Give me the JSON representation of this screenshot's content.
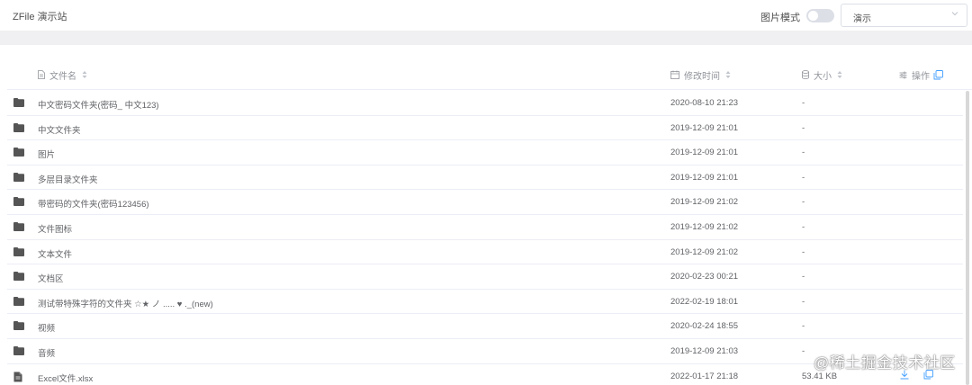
{
  "header": {
    "site_title": "ZFile 演示站",
    "image_mode_label": "图片模式",
    "image_mode_on": false,
    "drive_select_value": "演示"
  },
  "table": {
    "columns": {
      "name": "文件名",
      "time": "修改时间",
      "size": "大小",
      "ops": "操作"
    },
    "rows": [
      {
        "type": "folder",
        "name": "中文密码文件夹(密码_ 中文123)",
        "time": "2020-08-10 21:23",
        "size": "-"
      },
      {
        "type": "folder",
        "name": "中文文件夹",
        "time": "2019-12-09 21:01",
        "size": "-"
      },
      {
        "type": "folder",
        "name": "图片",
        "time": "2019-12-09 21:01",
        "size": "-"
      },
      {
        "type": "folder",
        "name": "多层目录文件夹",
        "time": "2019-12-09 21:01",
        "size": "-"
      },
      {
        "type": "folder",
        "name": "带密码的文件夹(密码123456)",
        "time": "2019-12-09 21:02",
        "size": "-"
      },
      {
        "type": "folder",
        "name": "文件图标",
        "time": "2019-12-09 21:02",
        "size": "-"
      },
      {
        "type": "folder",
        "name": "文本文件",
        "time": "2019-12-09 21:02",
        "size": "-"
      },
      {
        "type": "folder",
        "name": "文档区",
        "time": "2020-02-23 00:21",
        "size": "-"
      },
      {
        "type": "folder",
        "name": "测试带特殊字符的文件夹 ☆★ ノ ..... ♥ ._(new)",
        "time": "2022-02-19 18:01",
        "size": "-"
      },
      {
        "type": "folder",
        "name": "视频",
        "time": "2020-02-24 18:55",
        "size": "-"
      },
      {
        "type": "folder",
        "name": "音频",
        "time": "2019-12-09 21:03",
        "size": "-"
      },
      {
        "type": "file",
        "name": "Excel文件.xlsx",
        "time": "2022-01-17 21:18",
        "size": "53.41 KB"
      }
    ]
  },
  "watermark": "@稀土掘金技术社区",
  "colors": {
    "accent": "#409eff",
    "band": "#f0f0f2",
    "border": "#ebeef5",
    "text": "#606266",
    "header_text": "#909399"
  }
}
